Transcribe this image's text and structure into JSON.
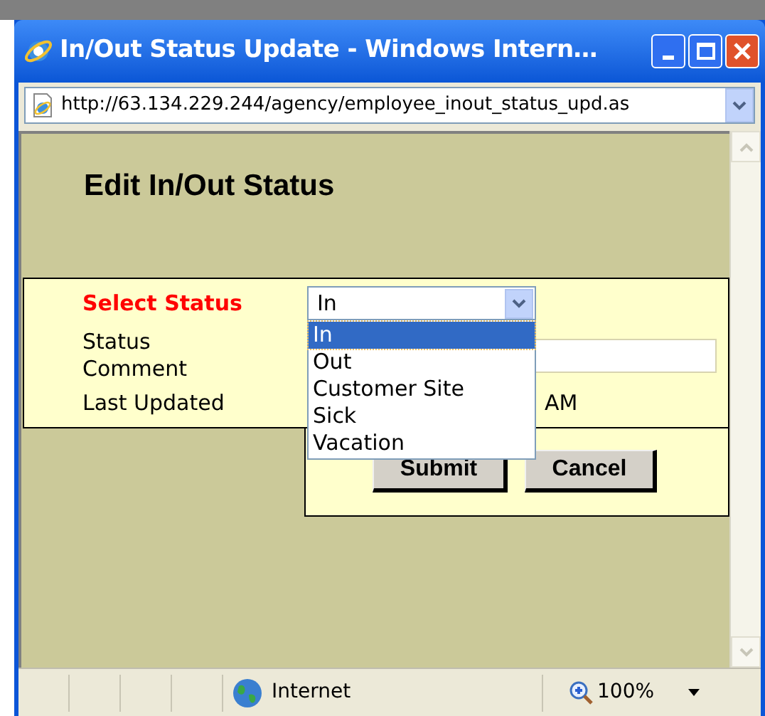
{
  "window": {
    "title": "In/Out Status Update - Windows Intern…"
  },
  "address_bar": {
    "url": "http://63.134.229.244/agency/employee_inout_status_upd.as"
  },
  "page": {
    "heading": "Edit In/Out Status",
    "status": {
      "label": "Select Status",
      "value": "In",
      "expanded": true,
      "options": [
        {
          "label": "In",
          "selected": true
        },
        {
          "label": "Out",
          "selected": false
        },
        {
          "label": "Customer Site",
          "selected": false
        },
        {
          "label": "Sick",
          "selected": false
        },
        {
          "label": "Vacation",
          "selected": false
        }
      ]
    },
    "comment": {
      "label": "Status Comment"
    },
    "last_updated": {
      "label": "Last Updated",
      "value": "AM"
    },
    "buttons": [
      "Submit",
      "Cancel"
    ]
  },
  "status_bar": {
    "zone": "Internet",
    "zoom": "100%"
  }
}
